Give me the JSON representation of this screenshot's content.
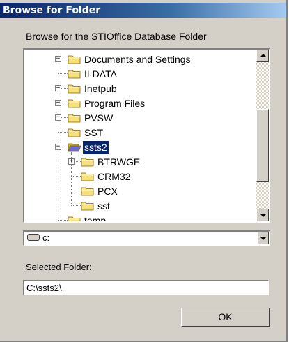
{
  "window": {
    "title": "Browse for Folder"
  },
  "instruction": "Browse for the STIOffice Database Folder",
  "tree": {
    "items": [
      {
        "label": "Documents and Settings",
        "expander": "+"
      },
      {
        "label": "ILDATA",
        "expander": ""
      },
      {
        "label": "Inetpub",
        "expander": "+"
      },
      {
        "label": "Program Files",
        "expander": "+"
      },
      {
        "label": "PVSW",
        "expander": "+"
      },
      {
        "label": "SST",
        "expander": ""
      },
      {
        "label": "ssts2",
        "expander": "−",
        "selected": true,
        "open": true
      },
      {
        "label": "BTRWGE",
        "expander": "+"
      },
      {
        "label": "CRM32",
        "expander": ""
      },
      {
        "label": "PCX",
        "expander": ""
      },
      {
        "label": "sst",
        "expander": ""
      },
      {
        "label": "temp",
        "expander": ""
      }
    ]
  },
  "drive": {
    "value": "c:"
  },
  "selected_folder": {
    "label": "Selected Folder:",
    "value": "C:\\ssts2\\"
  },
  "ok_button": {
    "label": "OK"
  },
  "colors": {
    "title_start": "#0a246a",
    "title_end": "#a6caf0",
    "face": "#d4d0c8",
    "selection": "#0a246a"
  }
}
